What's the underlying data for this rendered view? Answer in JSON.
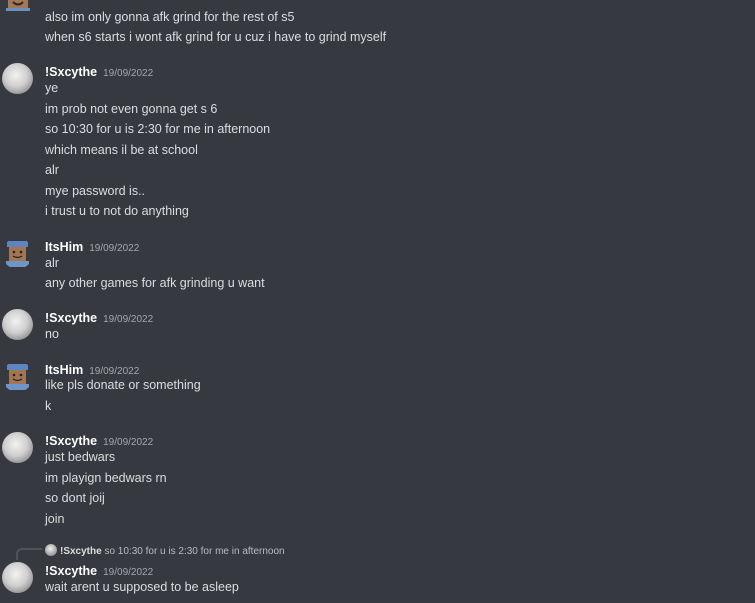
{
  "users": {
    "sxcythe": "!Sxcythe",
    "itshim": "ItsHim"
  },
  "date": "19/09/2022",
  "top": {
    "lines": [
      "also im only gonna afk grind for the rest of s5",
      "when s6 starts i wont afk grind for u cuz i have to grind myself"
    ]
  },
  "groups": [
    {
      "author": "!Sxcythe",
      "timestamp": "19/09/2022",
      "lines": [
        "ye",
        "im prob not even gonna get s 6",
        "so 10:30 for u is 2:30 for me in afternoon",
        "which means il be at school",
        "alr",
        "mye password is..",
        "i trust u to not do anything"
      ]
    },
    {
      "author": "ItsHim",
      "timestamp": "19/09/2022",
      "lines": [
        "alr",
        "any other games for afk grinding u want"
      ]
    },
    {
      "author": "!Sxcythe",
      "timestamp": "19/09/2022",
      "lines": [
        "no"
      ]
    },
    {
      "author": "ItsHim",
      "timestamp": "19/09/2022",
      "lines": [
        "like pls donate or something",
        "k"
      ]
    },
    {
      "author": "!Sxcythe",
      "timestamp": "19/09/2022",
      "lines": [
        "just bedwars",
        "im playign bedwars rn",
        "so dont joij",
        "join"
      ]
    },
    {
      "author": "!Sxcythe",
      "timestamp": "19/09/2022",
      "reply": {
        "author": "!Sxcythe",
        "text": "so 10:30 for u is 2:30 for me in afternoon"
      },
      "lines": [
        "wait arent u supposed to be asleep"
      ]
    }
  ],
  "colors": {
    "background": "#36393f",
    "text": "#dcddde",
    "username": "#ffffff",
    "timestamp": "#a3a6aa"
  },
  "icons": [
    "user-avatar",
    "roblox-avatar-icon"
  ]
}
